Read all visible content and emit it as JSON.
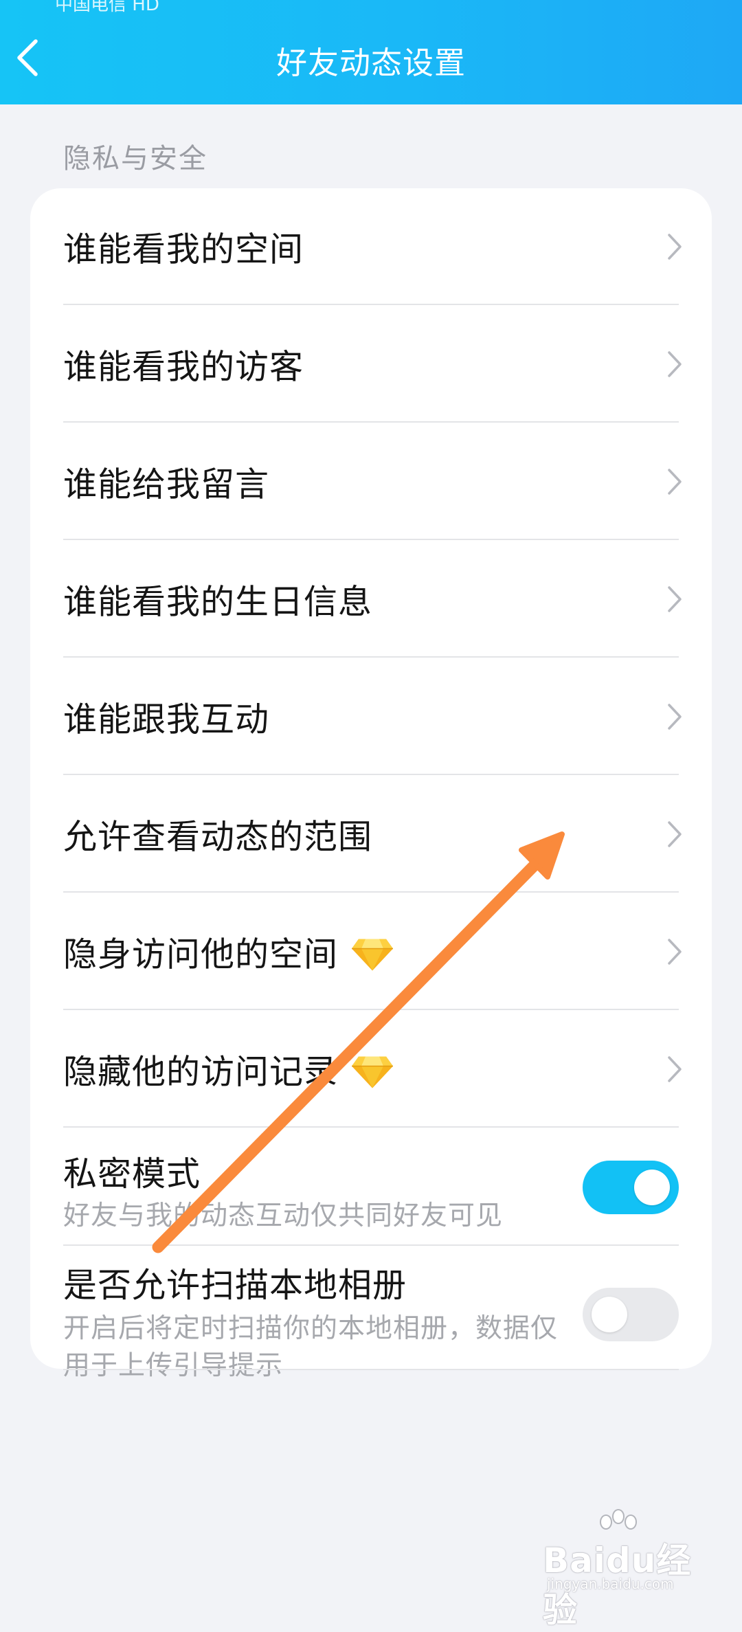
{
  "status_bar": {
    "carrier": "中国电信 HD"
  },
  "header": {
    "title": "好友动态设置"
  },
  "section": {
    "label": "隐私与安全"
  },
  "items": [
    {
      "label": "谁能看我的空间"
    },
    {
      "label": "谁能看我的访客"
    },
    {
      "label": "谁能给我留言"
    },
    {
      "label": "谁能看我的生日信息"
    },
    {
      "label": "谁能跟我互动"
    },
    {
      "label": "允许查看动态的范围"
    },
    {
      "label": "隐身访问他的空间",
      "icon": "diamond-vip-icon"
    },
    {
      "label": "隐藏他的访问记录",
      "icon": "diamond-vip-icon"
    }
  ],
  "private_mode": {
    "title": "私密模式",
    "description": "好友与我的动态互动仅共同好友可见",
    "enabled": true
  },
  "scan_album": {
    "title": "是否允许扫描本地相册",
    "description_line1": "开启后将定时扫描你的本地相册，数据仅",
    "description_line2": "用于上传引导提示",
    "enabled": false
  },
  "colors": {
    "header_gradient_start": "#16c4f6",
    "header_gradient_end": "#1ea8f5",
    "toggle_on": "#12c1f5",
    "annotation_arrow": "#fa8a3c"
  },
  "watermark": {
    "brand": "Baidu经验",
    "url": "jingyan.baidu.com"
  }
}
